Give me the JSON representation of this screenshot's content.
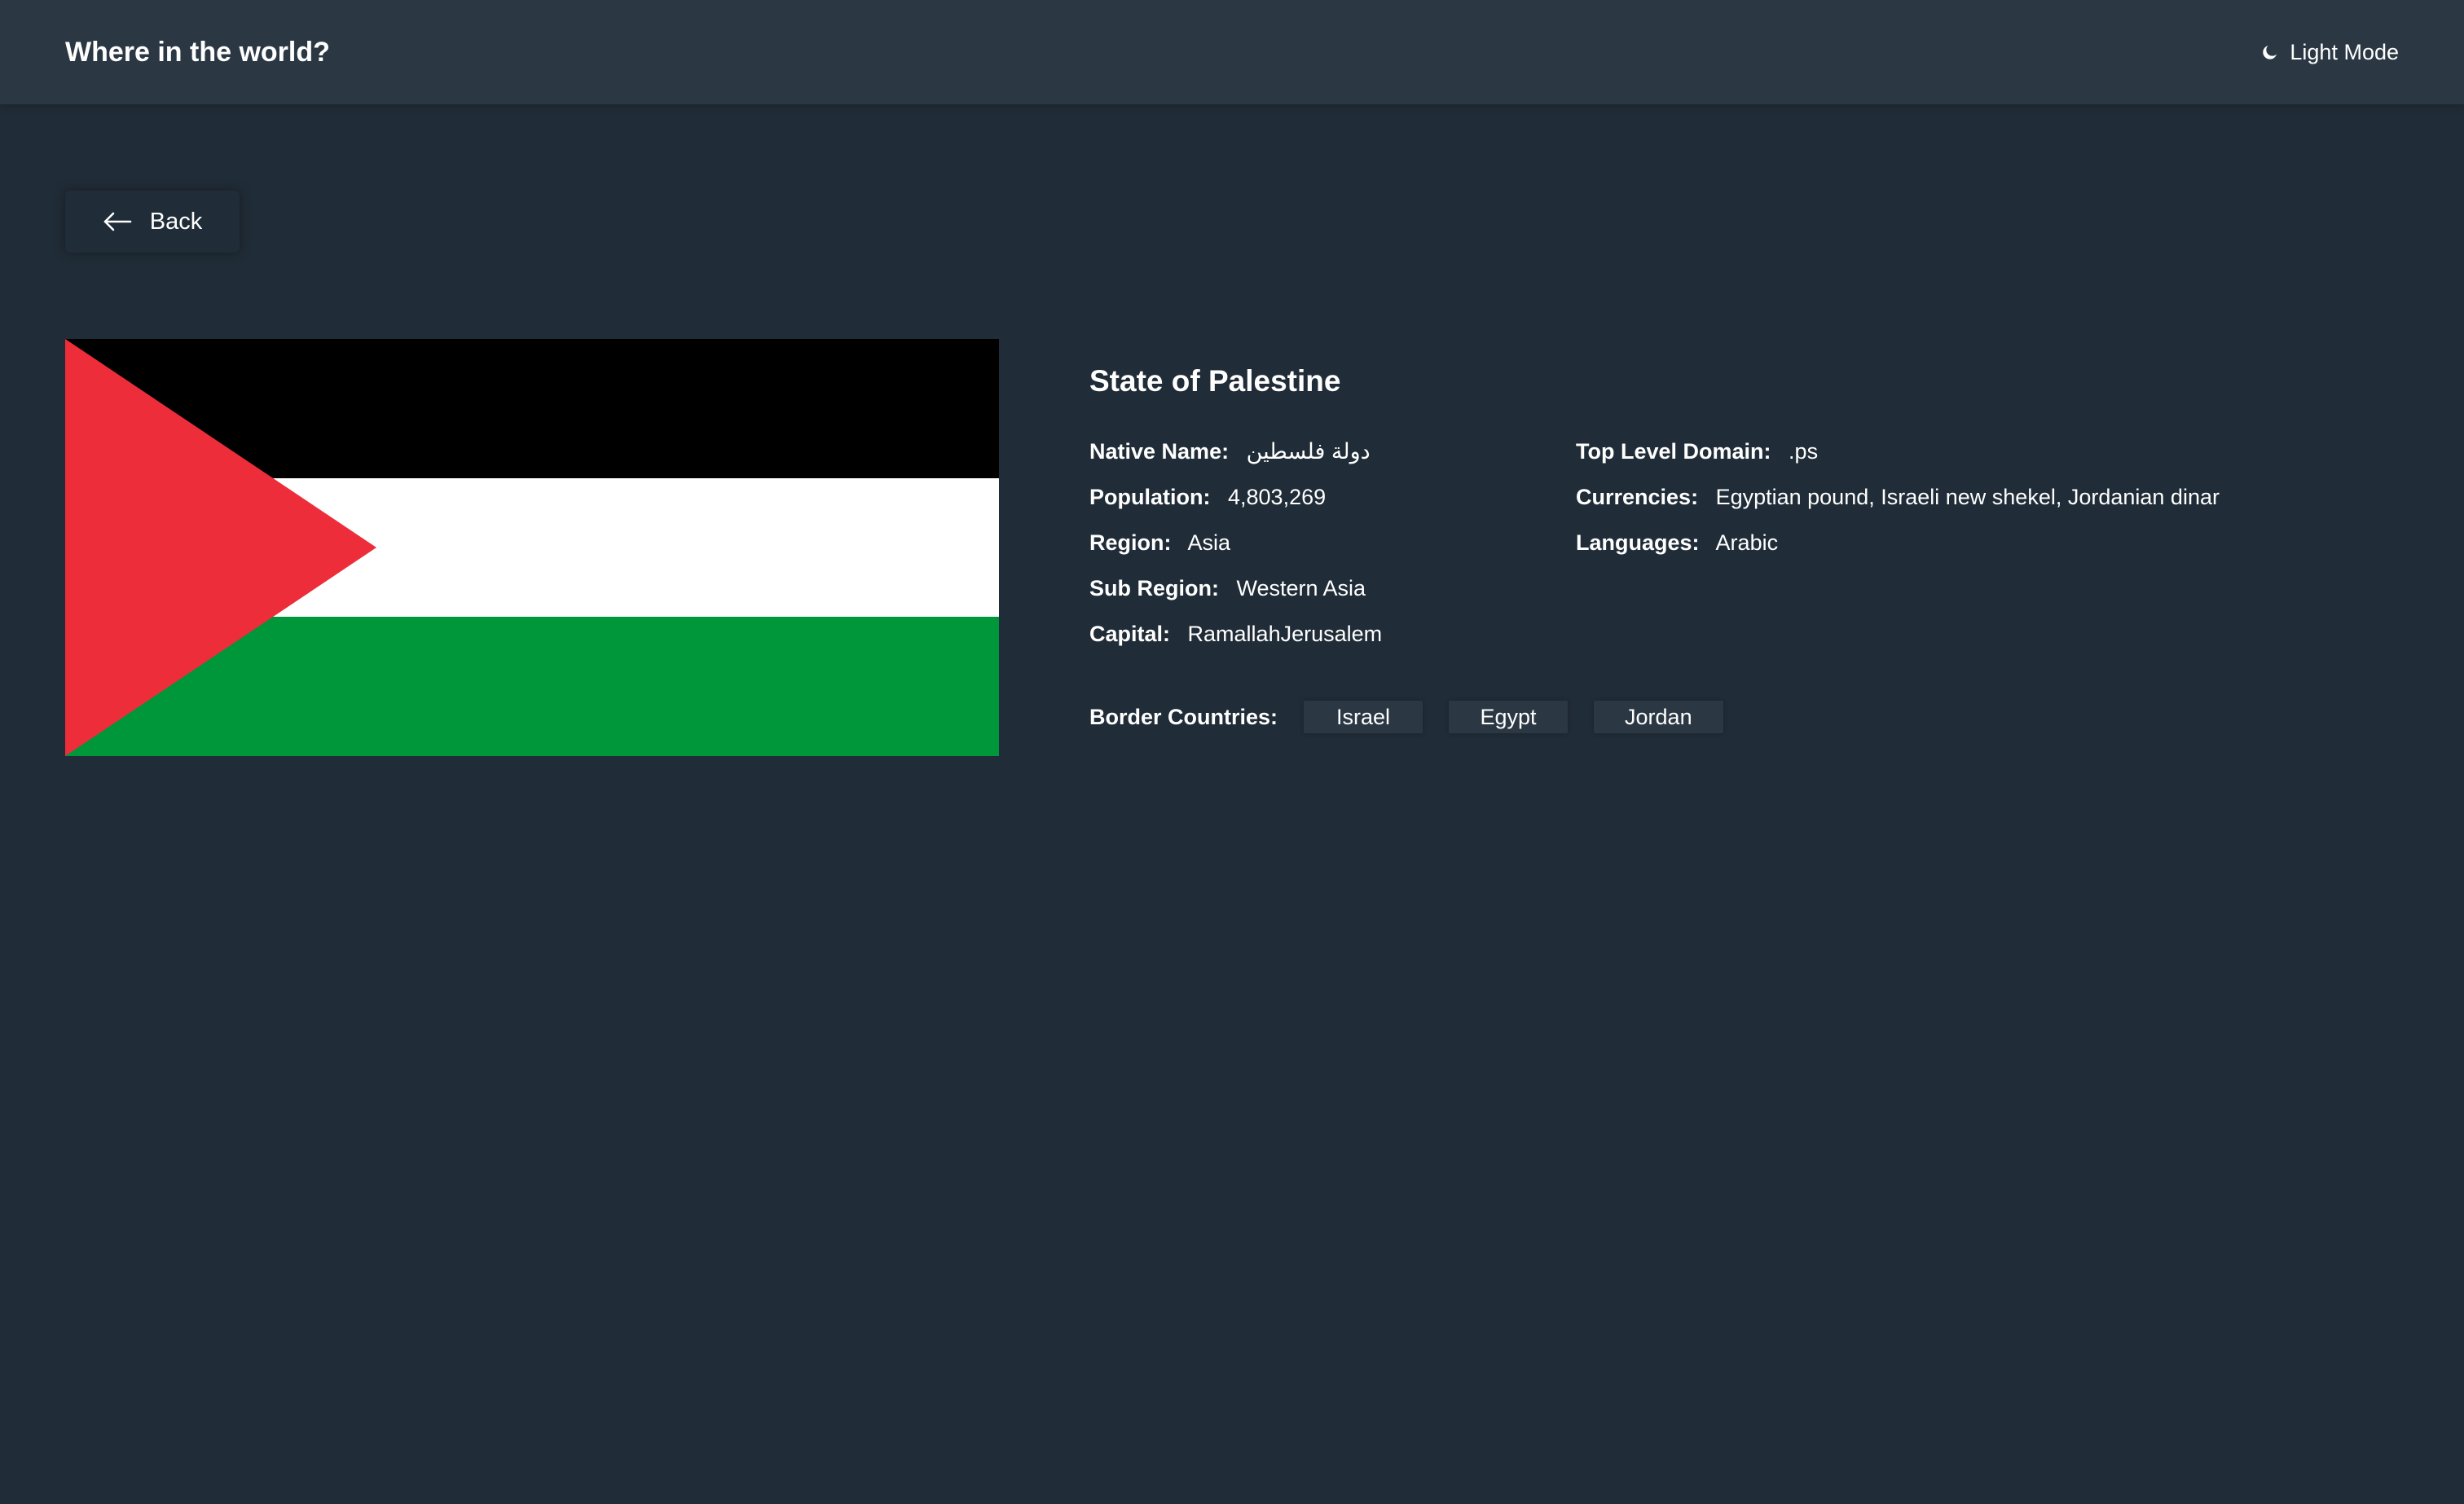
{
  "header": {
    "title": "Where in the world?",
    "mode_label": "Light Mode",
    "mode_icon": "moon-icon"
  },
  "back": {
    "label": "Back",
    "icon": "arrow-left-icon"
  },
  "flag": {
    "country": "State of Palestine",
    "colors": {
      "black": "#000000",
      "white": "#ffffff",
      "green": "#00963a",
      "red": "#ee2d3a"
    }
  },
  "country": {
    "name": "State of Palestine",
    "left": [
      {
        "label": "Native Name:",
        "value": "دولة فلسطين"
      },
      {
        "label": "Population:",
        "value": "4,803,269"
      },
      {
        "label": "Region:",
        "value": "Asia"
      },
      {
        "label": "Sub Region:",
        "value": "Western Asia"
      },
      {
        "label": "Capital:",
        "value": "RamallahJerusalem"
      }
    ],
    "right": [
      {
        "label": "Top Level Domain:",
        "value": ".ps"
      },
      {
        "label": "Currencies:",
        "value": "Egyptian pound, Israeli new shekel, Jordanian dinar"
      },
      {
        "label": "Languages:",
        "value": "Arabic"
      }
    ],
    "borders_label": "Border Countries:",
    "borders": [
      "Israel",
      "Egypt",
      "Jordan"
    ]
  },
  "theme": {
    "background": "#202c37",
    "surface": "#2b3844",
    "text": "#ffffff"
  }
}
